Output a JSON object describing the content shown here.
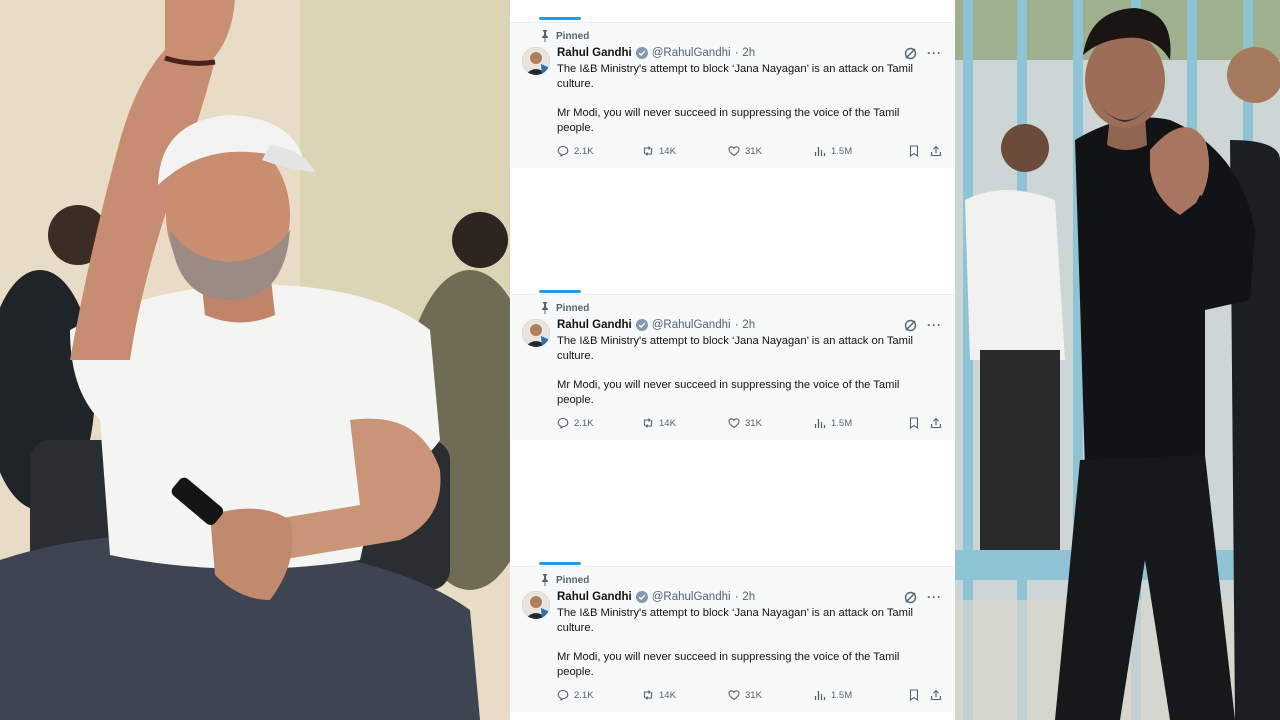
{
  "tweet": {
    "pinned_label": "Pinned",
    "author_name": "Rahul Gandhi",
    "author_handle": "@RahulGandhi",
    "separator": "·",
    "time": "2h",
    "more_glyph": "···",
    "paragraph_1": "The I&B Ministry's attempt to block ‘Jana Nayagan’ is an attack on Tamil culture.",
    "paragraph_2": "Mr Modi, you will never succeed in suppressing the voice of the Tamil people.",
    "replies": "2.1K",
    "reposts": "14K",
    "likes": "31K",
    "views": "1.5M",
    "icons": [
      "pin-icon",
      "verified-badge-icon",
      "grok-icon",
      "more-icon",
      "reply-icon",
      "retweet-icon",
      "like-icon",
      "views-icon",
      "bookmark-icon",
      "share-icon"
    ]
  },
  "colors": {
    "accent_blue": "#1d9bf0",
    "text_primary": "#0f1419",
    "text_secondary": "#536471",
    "card_background": "#f7f9f9"
  }
}
